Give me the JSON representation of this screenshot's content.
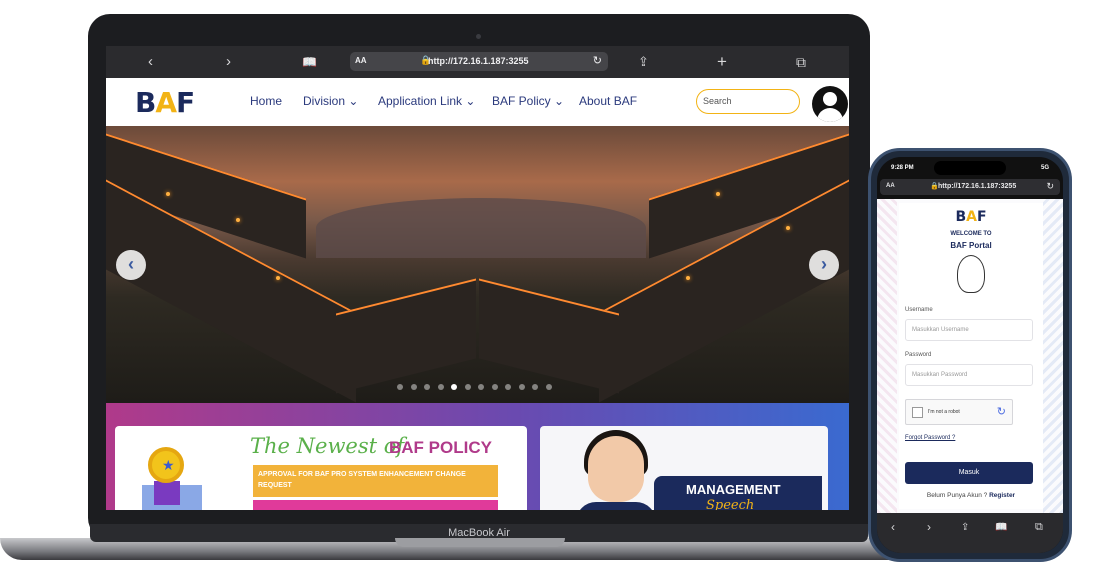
{
  "laptop": {
    "label": "MacBook Air"
  },
  "browser": {
    "aa": "AA",
    "url": "http://172.16.1.187:3255",
    "back_icon": "‹",
    "forward_icon": "›",
    "reader_icon": "📖",
    "share_icon": "⇪",
    "new_tab_icon": "+",
    "tabs_icon": "⧉",
    "reload_icon": "↻"
  },
  "site": {
    "logo_b": "B",
    "logo_a": "A",
    "logo_f": "F",
    "nav": [
      "Home",
      "Division ⌄",
      "Application Link ⌄",
      "BAF Policy ⌄",
      "About BAF"
    ],
    "search_placeholder": "Search"
  },
  "hero": {
    "prev": "‹",
    "next": "›",
    "slide_count": 12,
    "active_slide": 4
  },
  "policy_card": {
    "newest": "The Newest of",
    "title": "BAF POLICY",
    "item1": "APPROVAL FOR BAF PRO SYSTEM ENHANCEMENT CHANGE REQUEST"
  },
  "management_card": {
    "title": "MANAGEMENT",
    "subtitle": "Speech"
  },
  "phone": {
    "time": "9:28 PM",
    "signal": "5G",
    "aa": "AA",
    "url": "http://172.16.1.187:3255",
    "welcome": "WELCOME TO",
    "portal": "BAF Portal",
    "username_label": "Username",
    "username_placeholder": "Masukkan Username",
    "password_label": "Password",
    "password_placeholder": "Masukkan Password",
    "captcha_text": "I'm not a robot",
    "forgot": "Forgot Password ?",
    "submit": "Masuk",
    "no_account": "Belum Punya Akun ?",
    "register": "Register",
    "bottom_icons": [
      "‹",
      "›",
      "⇪",
      "📖",
      "⧉"
    ]
  }
}
